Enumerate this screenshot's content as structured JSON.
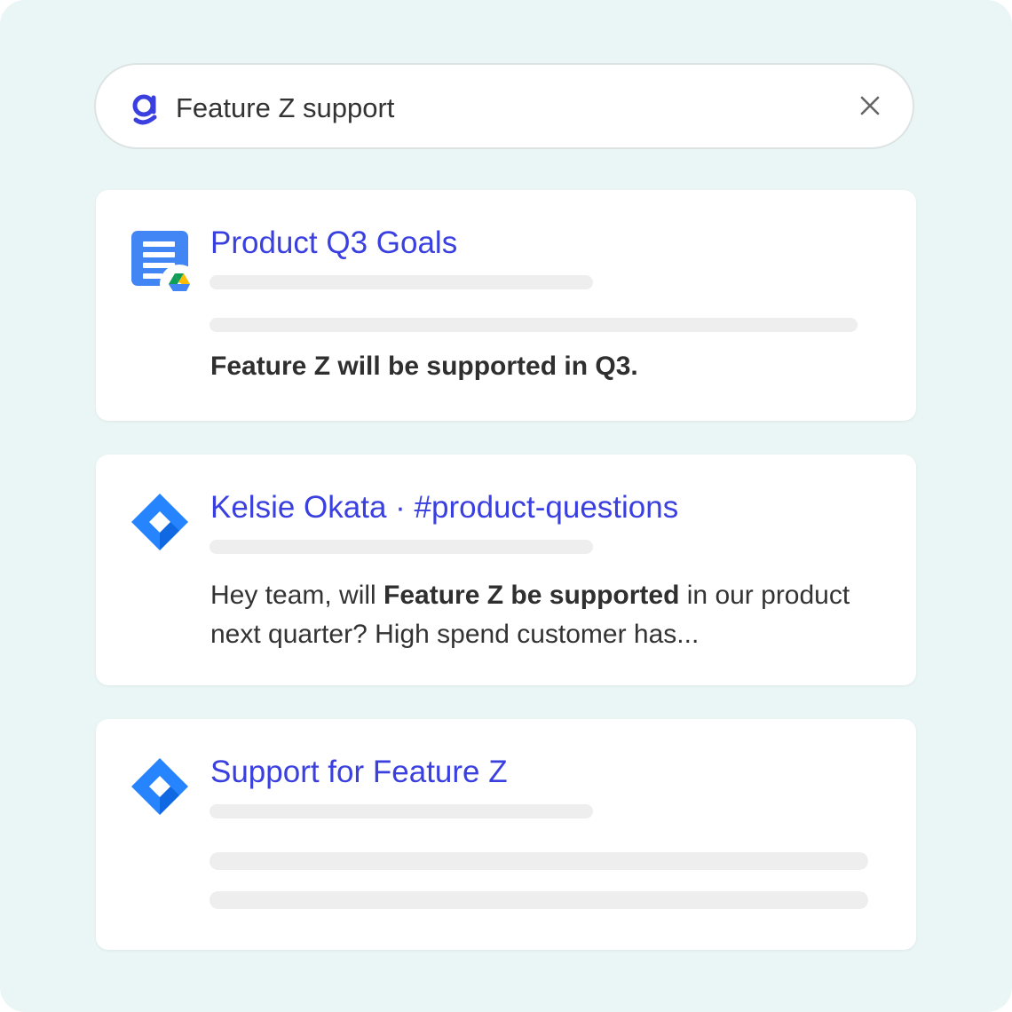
{
  "search": {
    "query": "Feature Z support"
  },
  "colors": {
    "background": "#eaf6f5",
    "title_link": "#3a3fe0",
    "brand": "#3a3fe0",
    "skeleton": "#eeeeee"
  },
  "results": [
    {
      "title": "Product Q3 Goals",
      "icon": "google-docs-icon",
      "badge_icon": "google-drive-icon",
      "snippet": "Feature Z will be supported in Q3."
    },
    {
      "title": "Kelsie Okata · #product-questions",
      "icon": "jira-icon",
      "snippet_before": "Hey team, will ",
      "snippet_bold": "Feature Z be supported",
      "snippet_after": " in our product next quarter? High spend customer has..."
    },
    {
      "title": "Support for Feature Z",
      "icon": "jira-icon"
    }
  ]
}
